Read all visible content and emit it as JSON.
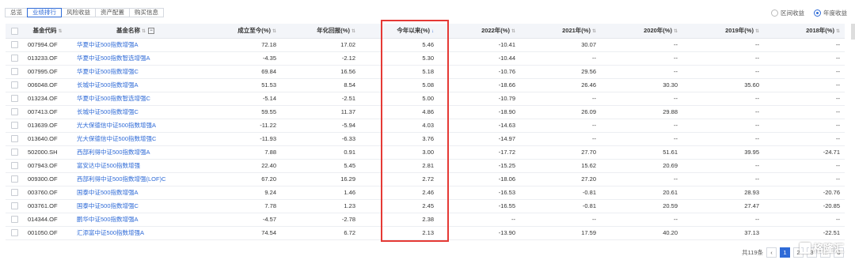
{
  "tabs": [
    "总览",
    "业绩排行",
    "风险收益",
    "资产配置",
    "购买信息"
  ],
  "radios": {
    "interval": "区间收益",
    "annual": "年度收益"
  },
  "headers": {
    "code": "基金代码",
    "name": "基金名称",
    "since": "成立至今(%)",
    "annualized": "年化回报(%)",
    "ytd": "今年以来(%)",
    "y2022": "2022年(%)",
    "y2021": "2021年(%)",
    "y2020": "2020年(%)",
    "y2019": "2019年(%)",
    "y2018": "2018年(%)"
  },
  "rows": [
    {
      "code": "007994.OF",
      "name": "华夏中证500指数增强A",
      "since": "72.18",
      "annualized": "17.02",
      "ytd": "5.46",
      "y2022": "-10.41",
      "y2021": "30.07",
      "y2020": "--",
      "y2019": "--",
      "y2018": "--"
    },
    {
      "code": "013233.OF",
      "name": "华夏中证500指数智选增强A",
      "since": "-4.35",
      "annualized": "-2.12",
      "ytd": "5.30",
      "y2022": "-10.44",
      "y2021": "--",
      "y2020": "--",
      "y2019": "--",
      "y2018": "--"
    },
    {
      "code": "007995.OF",
      "name": "华夏中证500指数增强C",
      "since": "69.84",
      "annualized": "16.56",
      "ytd": "5.18",
      "y2022": "-10.76",
      "y2021": "29.56",
      "y2020": "--",
      "y2019": "--",
      "y2018": "--"
    },
    {
      "code": "006048.OF",
      "name": "长城中证500指数增强A",
      "since": "51.53",
      "annualized": "8.54",
      "ytd": "5.08",
      "y2022": "-18.66",
      "y2021": "26.46",
      "y2020": "30.30",
      "y2019": "35.60",
      "y2018": "--"
    },
    {
      "code": "013234.OF",
      "name": "华夏中证500指数智选增强C",
      "since": "-5.14",
      "annualized": "-2.51",
      "ytd": "5.00",
      "y2022": "-10.79",
      "y2021": "--",
      "y2020": "--",
      "y2019": "--",
      "y2018": "--"
    },
    {
      "code": "007413.OF",
      "name": "长城中证500指数增强C",
      "since": "59.55",
      "annualized": "11.37",
      "ytd": "4.86",
      "y2022": "-18.90",
      "y2021": "26.09",
      "y2020": "29.88",
      "y2019": "--",
      "y2018": "--"
    },
    {
      "code": "013639.OF",
      "name": "光大保德信中证500指数增强A",
      "since": "-11.22",
      "annualized": "-5.94",
      "ytd": "4.03",
      "y2022": "-14.63",
      "y2021": "--",
      "y2020": "--",
      "y2019": "--",
      "y2018": "--"
    },
    {
      "code": "013640.OF",
      "name": "光大保德信中证500指数增强C",
      "since": "-11.93",
      "annualized": "-6.33",
      "ytd": "3.76",
      "y2022": "-14.97",
      "y2021": "--",
      "y2020": "--",
      "y2019": "--",
      "y2018": "--"
    },
    {
      "code": "502000.SH",
      "name": "西部利得中证500指数增强A",
      "since": "7.88",
      "annualized": "0.91",
      "ytd": "3.00",
      "y2022": "-17.72",
      "y2021": "27.70",
      "y2020": "51.61",
      "y2019": "39.95",
      "y2018": "-24.71"
    },
    {
      "code": "007943.OF",
      "name": "富安达中证500指数增强",
      "since": "22.40",
      "annualized": "5.45",
      "ytd": "2.81",
      "y2022": "-15.25",
      "y2021": "15.62",
      "y2020": "20.69",
      "y2019": "--",
      "y2018": "--"
    },
    {
      "code": "009300.OF",
      "name": "西部利得中证500指数增强(LOF)C",
      "since": "67.20",
      "annualized": "16.29",
      "ytd": "2.72",
      "y2022": "-18.06",
      "y2021": "27.20",
      "y2020": "--",
      "y2019": "--",
      "y2018": "--"
    },
    {
      "code": "003760.OF",
      "name": "国泰中证500指数增强A",
      "since": "9.24",
      "annualized": "1.46",
      "ytd": "2.46",
      "y2022": "-16.53",
      "y2021": "-0.81",
      "y2020": "20.61",
      "y2019": "28.93",
      "y2018": "-20.76"
    },
    {
      "code": "003761.OF",
      "name": "国泰中证500指数增强C",
      "since": "7.78",
      "annualized": "1.23",
      "ytd": "2.45",
      "y2022": "-16.55",
      "y2021": "-0.81",
      "y2020": "20.59",
      "y2019": "27.47",
      "y2018": "-20.85"
    },
    {
      "code": "014344.OF",
      "name": "鹏华中证500指数增强A",
      "since": "-4.57",
      "annualized": "-2.78",
      "ytd": "2.38",
      "y2022": "--",
      "y2021": "--",
      "y2020": "--",
      "y2019": "--",
      "y2018": "--"
    },
    {
      "code": "001050.OF",
      "name": "汇添富中证500指数增强A",
      "since": "74.54",
      "annualized": "6.72",
      "ytd": "2.13",
      "y2022": "-13.90",
      "y2021": "17.59",
      "y2020": "40.20",
      "y2019": "37.13",
      "y2018": "-22.51"
    }
  ],
  "pager": {
    "total": "共119条",
    "pages": [
      "1",
      "2",
      "3",
      "...",
      "8"
    ]
  },
  "watermark": "格隆汇",
  "colors": {
    "accent": "#2f6bd7",
    "highlight": "#e53935"
  }
}
